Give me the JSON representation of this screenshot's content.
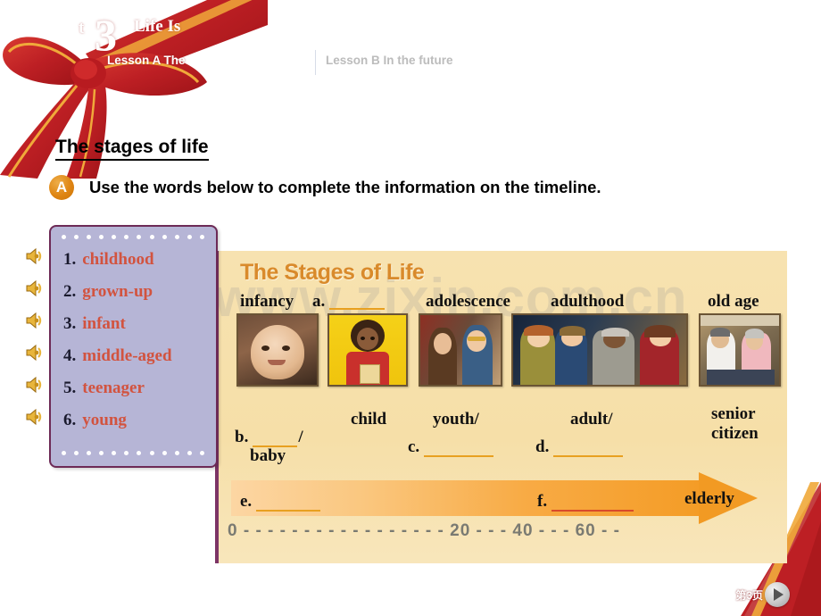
{
  "header": {
    "unit_word": "t",
    "unit_number": "3",
    "unit_title_rest": "Life Is",
    "tab_a": "Lesson A  The",
    "tab_b": "Lesson B In the future"
  },
  "section": {
    "heading": "The stages of life",
    "badge": "A",
    "instruction": "Use the words below to complete the information on the timeline."
  },
  "wordbox": {
    "items": [
      {
        "num": "1.",
        "word": "childhood"
      },
      {
        "num": "2.",
        "word": "grown-up"
      },
      {
        "num": "3.",
        "word": "infant"
      },
      {
        "num": "4.",
        "word": "middle-aged"
      },
      {
        "num": "5.",
        "word": "teenager"
      },
      {
        "num": "6.",
        "word": "young"
      }
    ],
    "speaker_icon": "speaker-icon"
  },
  "timeline": {
    "title": "The Stages of Life",
    "watermark": "www.zixin.com.cn",
    "stage_labels": [
      "infancy",
      "a.",
      "adolescence",
      "adulthood",
      "old age"
    ],
    "sub_labels": {
      "baby": "baby",
      "child": "child",
      "youth": "youth/",
      "adult": "adult/",
      "senior_line1": "senior",
      "senior_line2": "citizen"
    },
    "blanks": {
      "b": "b.",
      "b_suffix": "/",
      "c": "c.",
      "d": "d.",
      "e": "e.",
      "f": "f."
    },
    "arrow_end_label": "elderly",
    "scale": "0 - - - - - - - - - - - - - - - - - 20 - - - 40 - - - 60 - -"
  },
  "footer": {
    "page_label": "第3页",
    "next_icon": "play-next-icon"
  },
  "colors": {
    "accent_orange": "#e08214",
    "panel_bg": "#f6e0ab",
    "wordbox_bg": "#b6b5d6",
    "wordbox_border": "#6d2a56",
    "word_text": "#d2533f",
    "ribbon_red": "#c0272d"
  }
}
